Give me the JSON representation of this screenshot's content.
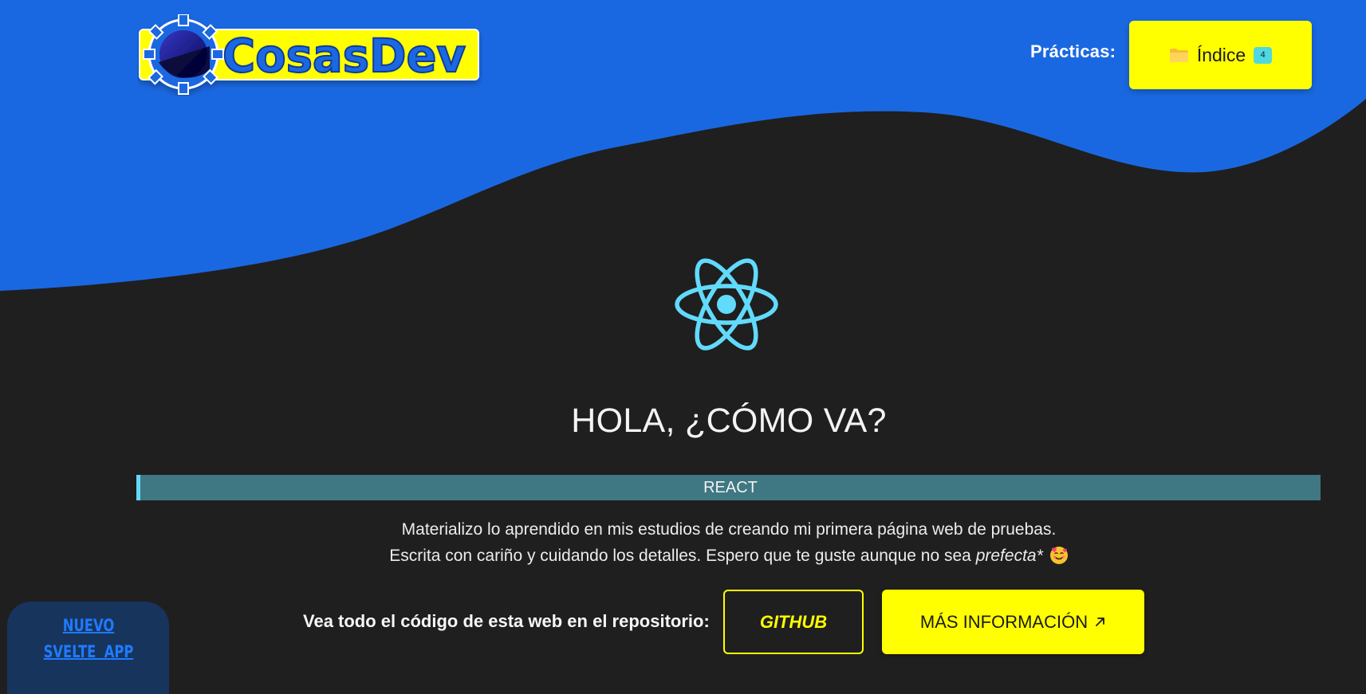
{
  "colors": {
    "header_background": "#1a68e1",
    "page_background": "#1f1f1f",
    "accent_yellow": "#ffff00",
    "react_cyan": "#61dafb",
    "banner_teal": "#3f7782",
    "svelte_panel": "#17345d",
    "link_blue": "#1f7bff"
  },
  "branding": {
    "logo_text": "CosasDev",
    "logo_icon": "gear-logo-icon"
  },
  "header": {
    "practicas_label": "Prácticas:",
    "index_button": {
      "icon": "folder-icon",
      "label": "Índice",
      "count": "4"
    }
  },
  "hero": {
    "logo_icon": "react-logo-icon",
    "title": "HOLA, ¿CÓMO VA?",
    "tech_banner": "REACT"
  },
  "intro": {
    "line1": "Materializo lo aprendido en mis estudios de creando mi primera página web de pruebas.",
    "line2_prefix": "Escrita con cariño y cuidando los detalles. Espero que te guste aunque no sea ",
    "line2_emphasis": "prefecta*",
    "emoji_icon": "smiling-face-with-hearts-icon"
  },
  "repository": {
    "label": "Vea todo el código de esta web en el repositorio:",
    "github_button": "GITHUB",
    "info_button": "MÁS INFORMACIÓN",
    "info_icon": "external-link-icon"
  },
  "svelte_panel": {
    "link_text": "NUEVO SVELTE APP"
  }
}
